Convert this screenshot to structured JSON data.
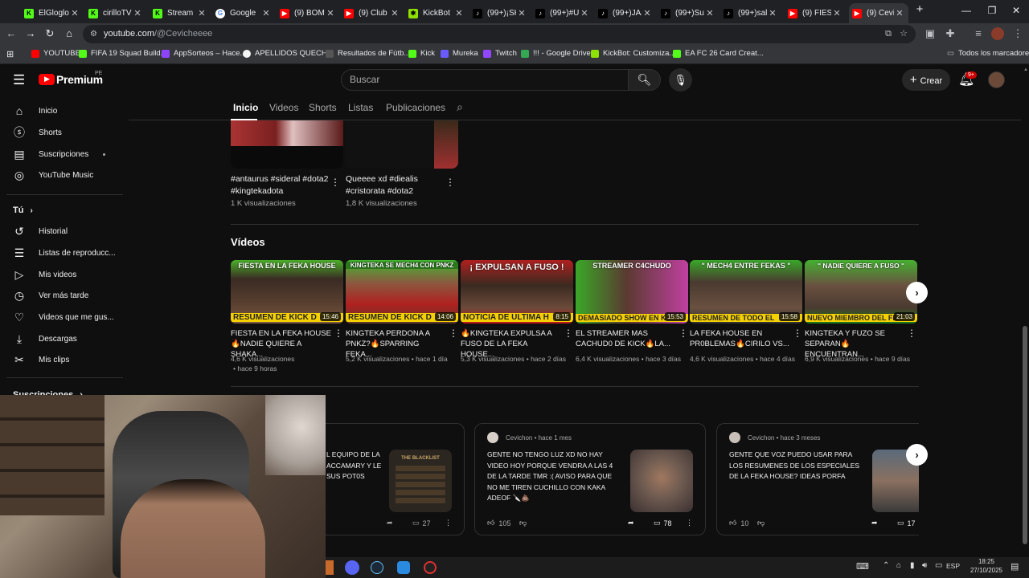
{
  "browser": {
    "tabs": [
      {
        "title": "ElGloglo",
        "fav_color": "#53fc18",
        "fav_glyph": "K"
      },
      {
        "title": "cirilloTV",
        "fav_color": "#53fc18",
        "fav_glyph": "K"
      },
      {
        "title": "Stream",
        "fav_color": "#53fc18",
        "fav_glyph": "K"
      },
      {
        "title": "Google",
        "fav_color": "#ffffff",
        "fav_glyph": "G"
      },
      {
        "title": "(9) BOMI",
        "fav_color": "#ff0000",
        "fav_glyph": "▶"
      },
      {
        "title": "(9) Club",
        "fav_color": "#ff0000",
        "fav_glyph": "▶"
      },
      {
        "title": "KickBot",
        "fav_color": "#8ee000",
        "fav_glyph": "✱"
      },
      {
        "title": "(99+)¡SKI",
        "fav_color": "#000000",
        "fav_glyph": "♪"
      },
      {
        "title": "(99+)#Ú",
        "fav_color": "#000000",
        "fav_glyph": "♪"
      },
      {
        "title": "(99+)JAJ",
        "fav_color": "#000000",
        "fav_glyph": "♪"
      },
      {
        "title": "(99+)Su",
        "fav_color": "#000000",
        "fav_glyph": "♪"
      },
      {
        "title": "(99+)sal",
        "fav_color": "#000000",
        "fav_glyph": "♪"
      },
      {
        "title": "(9) FIEST",
        "fav_color": "#ff0000",
        "fav_glyph": "▶"
      },
      {
        "title": "(9) Cevic",
        "fav_color": "#ff0000",
        "fav_glyph": "▶",
        "active": true
      }
    ],
    "new_tab": "+",
    "url_host": "youtube.com",
    "url_path": "/@Cevicheeee",
    "window_controls": [
      "—",
      "❐",
      "✕"
    ]
  },
  "bookmarks": [
    {
      "label": "YOUTUBE",
      "color": "#ff0000"
    },
    {
      "label": "FIFA 19 Squad Build...",
      "color": "#53fc18"
    },
    {
      "label": "AppSorteos – Hace...",
      "color": "#8e44ff"
    },
    {
      "label": "APELLIDOS QUECH...",
      "color": "#f5f5f5"
    },
    {
      "label": "Resultados de Fútb...",
      "color": "#555555"
    },
    {
      "label": "Kick",
      "color": "#53fc18"
    },
    {
      "label": "Mureka",
      "color": "#6b5bff"
    },
    {
      "label": "Twitch",
      "color": "#9146ff"
    },
    {
      "label": "!!! - Google Drive",
      "color": "#34a853"
    },
    {
      "label": "KickBot: Customiza...",
      "color": "#8ee000"
    },
    {
      "label": "EA FC 26 Card Creat...",
      "color": "#53fc18"
    }
  ],
  "bookmarks_all": "Todos los marcadores",
  "yt": {
    "logo_text": "Premium",
    "logo_region": "PE",
    "search_placeholder": "Buscar",
    "create_label": "Crear",
    "notif_count": "9+"
  },
  "sidebar": {
    "main": [
      {
        "label": "Inicio",
        "icon": "home-icon",
        "glyph": "⌂"
      },
      {
        "label": "Shorts",
        "icon": "shorts-icon",
        "glyph": "ⓢ"
      },
      {
        "label": "Suscripciones",
        "icon": "subscriptions-icon",
        "glyph": "▤",
        "dot": true
      },
      {
        "label": "YouTube Music",
        "icon": "music-icon",
        "glyph": "◎"
      }
    ],
    "you_label": "Tú",
    "you": [
      {
        "label": "Historial",
        "icon": "history-icon",
        "glyph": "↺"
      },
      {
        "label": "Listas de reproducc...",
        "icon": "playlists-icon",
        "glyph": "☰"
      },
      {
        "label": "Mis videos",
        "icon": "my-videos-icon",
        "glyph": "▷"
      },
      {
        "label": "Ver más tarde",
        "icon": "watch-later-icon",
        "glyph": "◷"
      },
      {
        "label": "Videos que me gus...",
        "icon": "liked-icon",
        "glyph": "👍"
      },
      {
        "label": "Descargas",
        "icon": "downloads-icon",
        "glyph": "⤓"
      },
      {
        "label": "Mis clips",
        "icon": "clips-icon",
        "glyph": "✂"
      }
    ],
    "subscriptions_header": "Suscripciones"
  },
  "channel_tabs": [
    "Inicio",
    "Videos",
    "Shorts",
    "Listas",
    "Publicaciones"
  ],
  "shorts": [
    {
      "title": "#antaurus #sideral #dota2 #kingtekadota",
      "views": "1 K visualizaciones"
    },
    {
      "title": "Queeee xd #diealis #cristorata #dota2",
      "views": "1,8 K visualizaciones"
    }
  ],
  "videos_section_title": "Vídeos",
  "videos": [
    {
      "title": "FIESTA EN LA FEKA HOUSE 🔥NADIE QUIERE A SHAKA...",
      "meta1": "4,6 K visualizaciones",
      "meta2": "• hace 9 horas",
      "duration": "15:46",
      "banner_top": "FIESTA EN LA FEKA HOUSE",
      "banner_bottom": "RESUMEN DE KICK D",
      "bg": "#3a2b24"
    },
    {
      "title": "KINGTEKA PERDONA A PNKZ?🔥SPARRING FEKA...",
      "meta1": "5,2 K visualizaciones • hace 1 día",
      "meta2": "",
      "duration": "14:06",
      "banner_top": "KINGTEKA SE MECH4 CON PNKZ",
      "banner_bottom": "RESUMEN DE KICK D",
      "bg": "#4a3328"
    },
    {
      "title": "🔥KINGTEKA EXPULSA A FUSO DE LA FEKA HOUSE...",
      "meta1": "5,3 K visualizaciones • hace 2 días",
      "meta2": "",
      "duration": "8:15",
      "banner_top": "¡ EXPULSAN A FUSO !",
      "banner_bottom": "NOTICIA DE ULTIMA H",
      "bg": "#2a1a14"
    },
    {
      "title": "EL STREAMER MAS CACHUD0 DE KICK🔥LA...",
      "meta1": "6,4 K visualizaciones • hace 3 días",
      "meta2": "",
      "duration": "15:53",
      "banner_top": "STREAMER C4CHUDO",
      "banner_bottom": "DEMASIADO SHOW EN K",
      "bg": "#3b2d2a"
    },
    {
      "title": "LA FEKA HOUSE EN PR0BLEMAS🔥CIRILO VS...",
      "meta1": "4,6 K visualizaciones • hace 4 días",
      "meta2": "",
      "duration": "15:58",
      "banner_top": "\" MECH4 ENTRE FEKAS \"",
      "banner_bottom": "RESUMEN DE TODO EL",
      "bg": "#332622"
    },
    {
      "title": "KINGTEKA Y FUZO SE SEPARAN🔥ENCUENTRAN...",
      "meta1": "6,9 K visualizaciones • hace 9 días",
      "meta2": "",
      "duration": "21:03",
      "banner_top": "\" NADIE QUIERE A FUSO \"",
      "banner_bottom": "NUEVO MIEMBRO DEL FE",
      "bg": "#3a2b22"
    }
  ],
  "posts": [
    {
      "author": "",
      "time": "",
      "text": "L EQUIPO DE LA ACCAMARY Y LE SUS POT0S",
      "likes": "",
      "comments": "27",
      "img_bg": "#2b2620",
      "img_caption": "THE BLACKLIST"
    },
    {
      "author": "Cevichon",
      "time": "• hace 1 mes",
      "text": "GENTE NO TENGO LUZ XD NO HAY VIDEO HOY PORQUE VENDRA A LAS 4 DE LA TARDE TMR :( AVISO PARA QUE NO ME TIREN CUCHILLO CON KAKA ADEOF 🔪💩",
      "likes": "105",
      "comments": "78",
      "img_bg": "#6d5a50",
      "img_caption": ""
    },
    {
      "author": "Cevichon",
      "time": "• hace 3 meses",
      "text": "GENTE QUE VOZ PUEDO USAR PARA LOS RESUMENES DE LOS ESPECIALES DE LA FEKA HOUSE? IDEAS PORFA",
      "likes": "10",
      "comments": "17",
      "img_bg": "#7a6a60",
      "img_caption": ""
    }
  ],
  "taskbar": {
    "time": "18:25",
    "date": "27/10/2025",
    "lang": "ESP"
  }
}
